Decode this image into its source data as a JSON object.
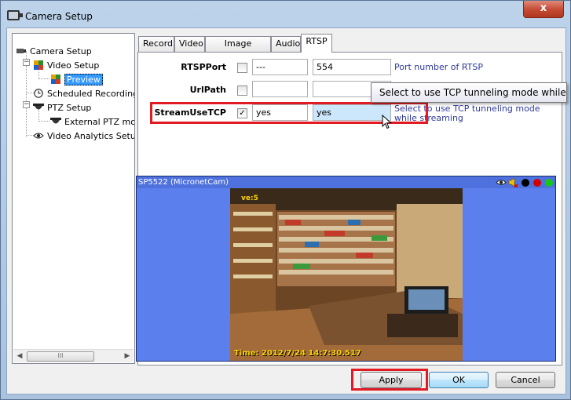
{
  "window": {
    "title": "Camera Setup",
    "close_label": "x"
  },
  "tree": {
    "items": [
      {
        "label": "Camera Setup",
        "icon": "camera-icon"
      },
      {
        "label": "Video Setup",
        "icon": "grid-icon"
      },
      {
        "label": "Preview",
        "icon": "grid-icon",
        "selected": true
      },
      {
        "label": "Scheduled Recording",
        "icon": "clock-icon"
      },
      {
        "label": "PTZ Setup",
        "icon": "dome-camera-icon"
      },
      {
        "label": "External PTZ moc",
        "icon": "dome-camera-icon"
      },
      {
        "label": "Video Analytics Setup",
        "icon": "eye-icon"
      }
    ],
    "scrollbar_thumb": "III"
  },
  "tabs": [
    {
      "label": "Record"
    },
    {
      "label": "Video"
    },
    {
      "label": "Image Adjust."
    },
    {
      "label": "Audio"
    },
    {
      "label": "RTSP",
      "active": true
    }
  ],
  "rtsp": {
    "rows": [
      {
        "label": "RTSPPort",
        "checked": false,
        "value1": "---",
        "value2": "554",
        "hint": "Port number of RTSP"
      },
      {
        "label": "UrlPath",
        "checked": false,
        "value1": "",
        "value2": "",
        "hint": ""
      },
      {
        "label": "StreamUseTCP",
        "checked": true,
        "value1": "yes",
        "value2": "yes",
        "hint": "Select to use TCP tunneling mode while streaming"
      }
    ],
    "check_glyph": "✓",
    "tooltip": "Select to use TCP tunneling mode while streaming"
  },
  "video": {
    "camera_name": "SP5522 (MicronetCam)",
    "timestamp": "Time: 2012/7/24 14:7:30.517",
    "corner_label": "ve:5",
    "control_colors": [
      "#000000",
      "#d40000",
      "#14c814"
    ]
  },
  "buttons": {
    "apply": "Apply",
    "ok": "OK",
    "cancel": "Cancel"
  },
  "colors": {
    "highlight_red": "#e01b24",
    "selection_blue": "#3399ff",
    "video_background": "#5b7fec"
  }
}
